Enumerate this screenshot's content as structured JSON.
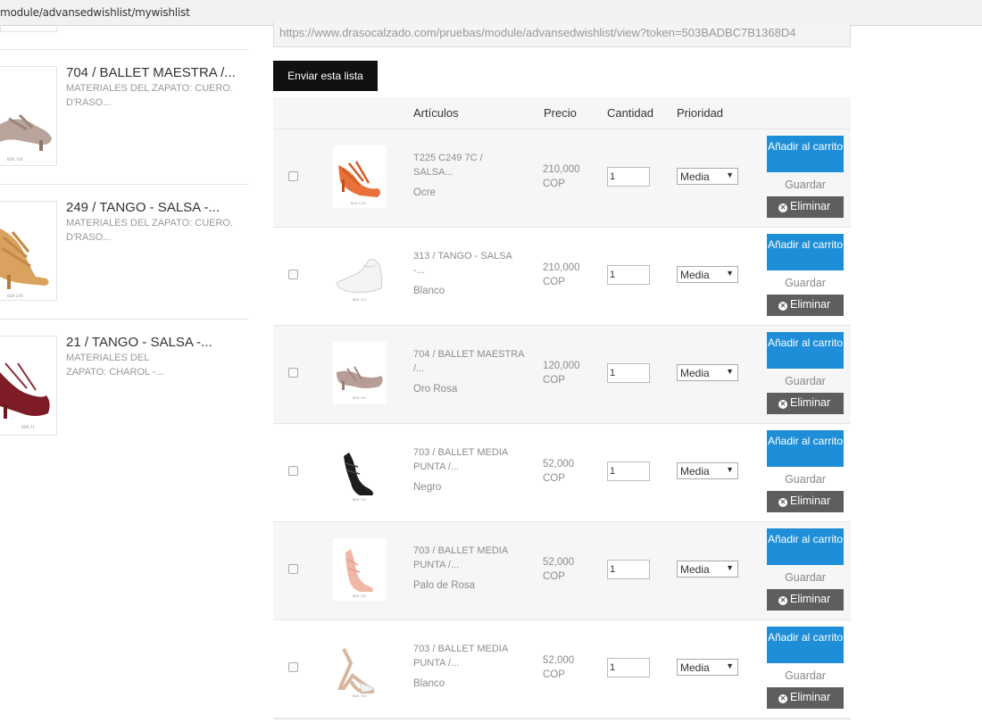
{
  "address_bar": {
    "url_fragment": "module/advansedwishlist/mywishlist"
  },
  "sidebar": {
    "items": [
      {
        "name": "704 / BALLET MAESTRA /...",
        "desc": "MATERIALES DEL ZAPATO: CUERO. D'RASO..."
      },
      {
        "name": "249 / TANGO - SALSA -...",
        "desc": "MATERIALES DEL ZAPATO: CUERO. D'RASO..."
      },
      {
        "name": "21 / TANGO - SALSA -...",
        "desc": "MATERIALES DEL ZAPATO: CHAROL -..."
      }
    ]
  },
  "share_url": "https://www.drasocalzado.com/pruebas/module/advansedwishlist/view?token=503BADBC7B1368D4",
  "send_button": "Enviar esta lista",
  "table": {
    "headers": {
      "articles": "Artículos",
      "price": "Precio",
      "qty": "Cantidad",
      "priority": "Prioridad"
    },
    "rows": [
      {
        "name": "T225 C249 7C / SALSA...",
        "attr": "Ocre",
        "price": "210,000 COP",
        "qty": "1",
        "priority": "Media"
      },
      {
        "name": "313 / TANGO - SALSA -...",
        "attr": "Blanco",
        "price": "210,000 COP",
        "qty": "1",
        "priority": "Media"
      },
      {
        "name": "704 / BALLET MAESTRA /...",
        "attr": "Oro Rosa",
        "price": "120,000 COP",
        "qty": "1",
        "priority": "Media"
      },
      {
        "name": "703 / BALLET MEDIA PUNTA /...",
        "attr": "Negro",
        "price": "52,000 COP",
        "qty": "1",
        "priority": "Media"
      },
      {
        "name": "703 / BALLET MEDIA PUNTA /...",
        "attr": "Palo de Rosa",
        "price": "52,000 COP",
        "qty": "1",
        "priority": "Media"
      },
      {
        "name": "703 / BALLET MEDIA PUNTA /...",
        "attr": "Blanco",
        "price": "52,000 COP",
        "qty": "1",
        "priority": "Media"
      }
    ],
    "actions": {
      "add_to_cart": "Añadir al carrito",
      "save": "Guardar",
      "delete": "Eliminar"
    }
  },
  "colors": {
    "accent": "#1e8ed8",
    "dark_button": "#111111",
    "delete_button": "#5e5e5e"
  }
}
